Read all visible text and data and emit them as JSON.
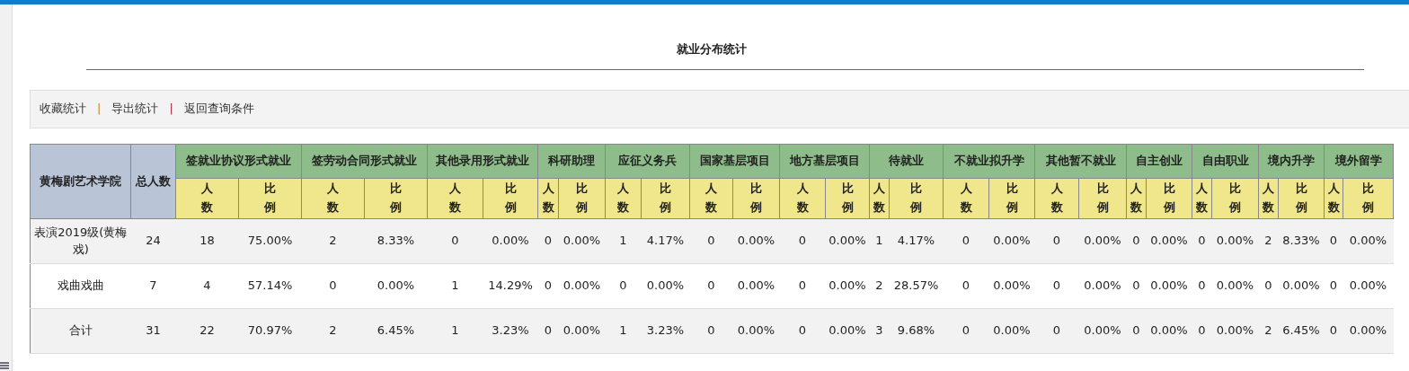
{
  "title": "就业分布统计",
  "toolbar": [
    {
      "kind": "link",
      "text": "收藏统计"
    },
    {
      "kind": "separator",
      "text": "|"
    },
    {
      "kind": "link",
      "text": "导出统计"
    },
    {
      "kind": "separator",
      "text": "|"
    },
    {
      "kind": "link",
      "text": "返回查询条件"
    }
  ],
  "table": {
    "college": "黄梅剧艺术学院",
    "total_label": "总人数",
    "groups": [
      {
        "label": "签就业协议形式就业",
        "subs": [
          "人数",
          "比例"
        ]
      },
      {
        "label": "签劳动合同形式就业",
        "subs": [
          "人数",
          "比例"
        ]
      },
      {
        "label": "其他录用形式就业",
        "subs": [
          "人数",
          "比例"
        ]
      },
      {
        "label": "科研助理",
        "subs": [
          "人数",
          "比例"
        ]
      },
      {
        "label": "应征义务兵",
        "subs": [
          "人数",
          "比例"
        ]
      },
      {
        "label": "国家基层项目",
        "subs": [
          "人数",
          "比例"
        ]
      },
      {
        "label": "地方基层项目",
        "subs": [
          "人数",
          "比例"
        ]
      },
      {
        "label": "待就业",
        "subs": [
          "人数",
          "比例"
        ]
      },
      {
        "label": "不就业拟升学",
        "subs": [
          "人数",
          "比例"
        ]
      },
      {
        "label": "其他暂不就业",
        "subs": [
          "人数",
          "比例"
        ]
      },
      {
        "label": "自主创业",
        "subs": [
          "人数",
          "比例"
        ]
      },
      {
        "label": "自由职业",
        "subs": [
          "人数",
          "比例"
        ]
      },
      {
        "label": "境内升学",
        "subs": [
          "人数",
          "比例"
        ]
      },
      {
        "label": "境外留学",
        "subs": [
          "人数",
          "比例"
        ]
      }
    ],
    "rows": [
      {
        "name": "表演2019级(黄梅戏)",
        "total": "24",
        "cells": [
          "18",
          "75.00%",
          "2",
          "8.33%",
          "0",
          "0.00%",
          "0",
          "0.00%",
          "1",
          "4.17%",
          "0",
          "0.00%",
          "0",
          "0.00%",
          "1",
          "4.17%",
          "0",
          "0.00%",
          "0",
          "0.00%",
          "0",
          "0.00%",
          "0",
          "0.00%",
          "2",
          "8.33%",
          "0",
          "0.00%"
        ]
      },
      {
        "name": "戏曲戏曲",
        "total": "7",
        "cells": [
          "4",
          "57.14%",
          "0",
          "0.00%",
          "1",
          "14.29%",
          "0",
          "0.00%",
          "0",
          "0.00%",
          "0",
          "0.00%",
          "0",
          "0.00%",
          "2",
          "28.57%",
          "0",
          "0.00%",
          "0",
          "0.00%",
          "0",
          "0.00%",
          "0",
          "0.00%",
          "0",
          "0.00%",
          "0",
          "0.00%"
        ]
      },
      {
        "name": "合计",
        "total": "31",
        "cells": [
          "22",
          "70.97%",
          "2",
          "6.45%",
          "1",
          "3.23%",
          "0",
          "0.00%",
          "1",
          "3.23%",
          "0",
          "0.00%",
          "0",
          "0.00%",
          "3",
          "9.68%",
          "0",
          "0.00%",
          "0",
          "0.00%",
          "0",
          "0.00%",
          "0",
          "0.00%",
          "2",
          "6.45%",
          "0",
          "0.00%"
        ]
      }
    ]
  }
}
